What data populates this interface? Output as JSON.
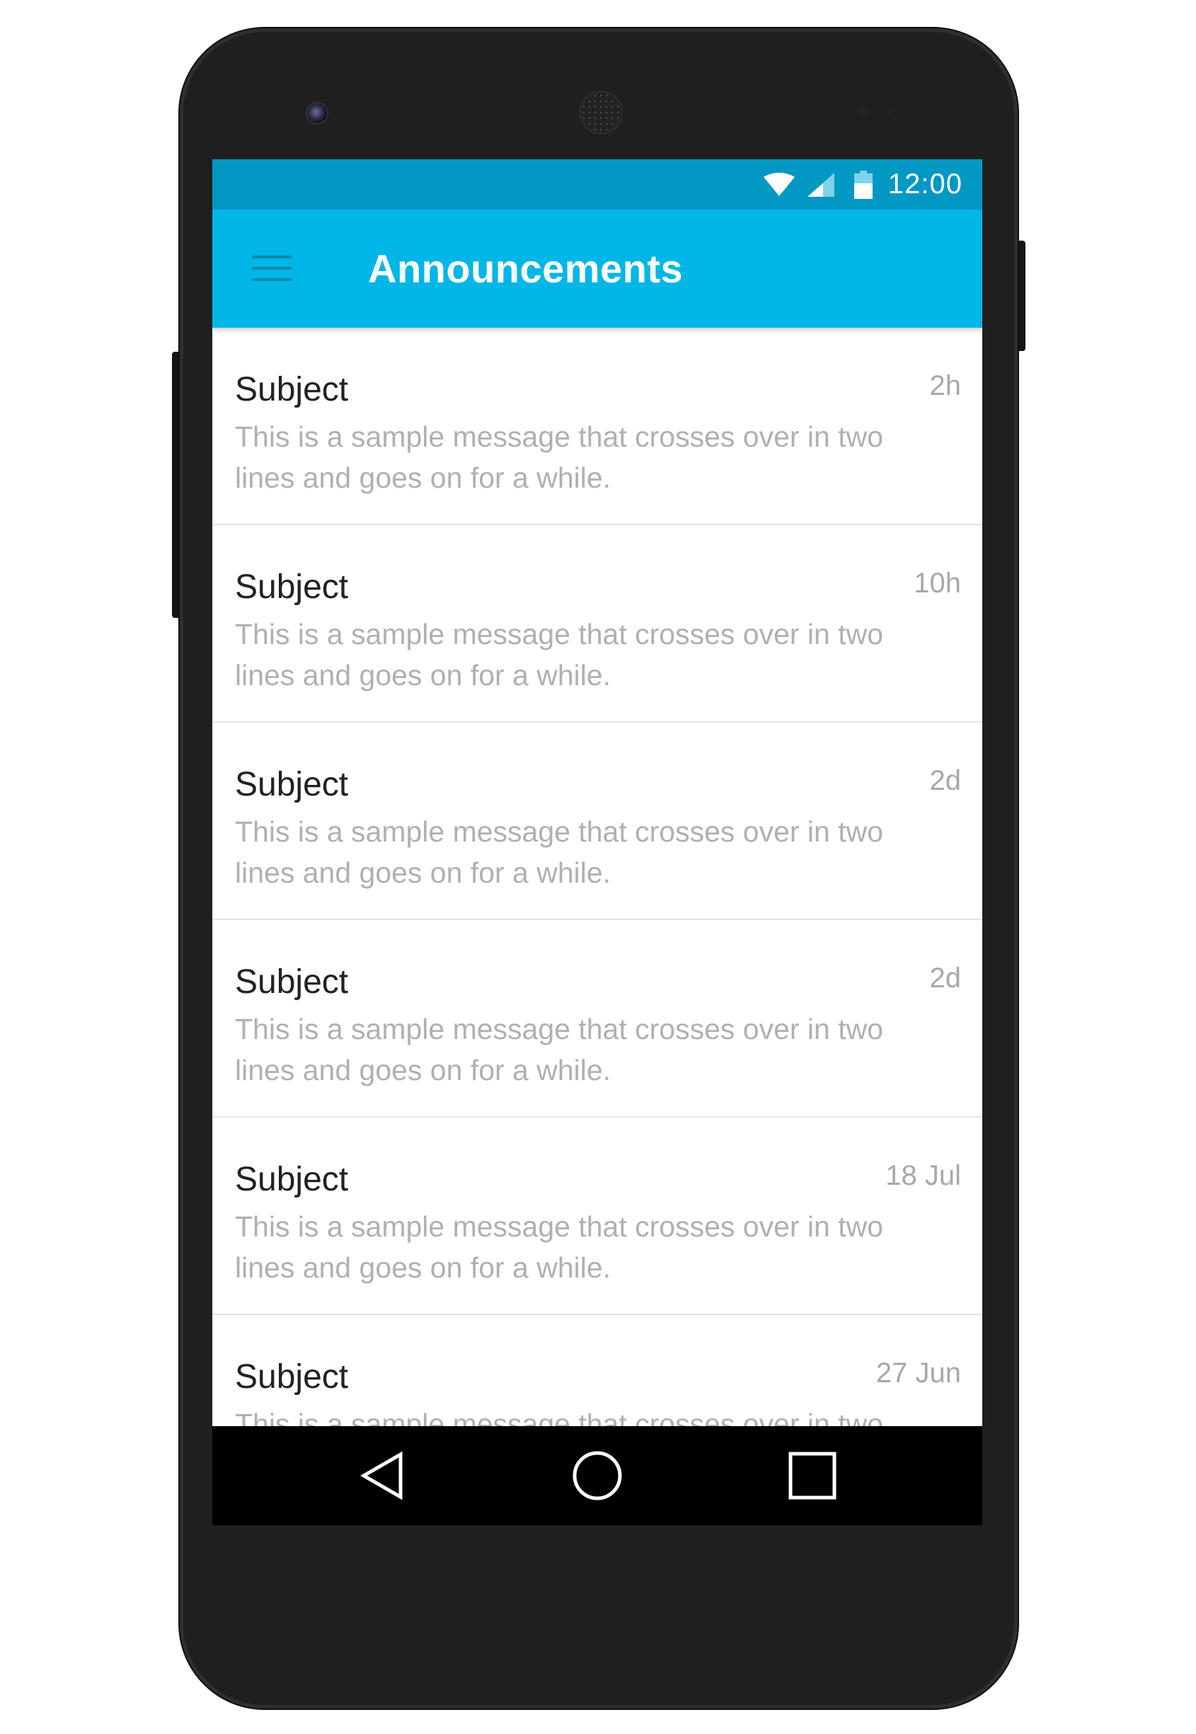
{
  "status_bar": {
    "time": "12:00",
    "icons": [
      "wifi-icon",
      "cell-signal-icon",
      "battery-icon"
    ]
  },
  "app_bar": {
    "menu_icon": "hamburger-menu-icon",
    "title": "Announcements",
    "color": "#00b6e6",
    "status_color": "#0198c4"
  },
  "announcements": [
    {
      "subject": "Subject",
      "time": "2h",
      "message": "This is a sample message that crosses over in two lines and goes on for a while."
    },
    {
      "subject": "Subject",
      "time": "10h",
      "message": "This is a sample message that crosses over in two lines and goes on for a while."
    },
    {
      "subject": "Subject",
      "time": "2d",
      "message": "This is a sample message that crosses over in two lines and goes on for a while."
    },
    {
      "subject": "Subject",
      "time": "2d",
      "message": "This is a sample message that crosses over in two lines and goes on for a while."
    },
    {
      "subject": "Subject",
      "time": "18 Jul",
      "message": "This is a sample message that crosses over in two lines and goes on for a while."
    },
    {
      "subject": "Subject",
      "time": "27 Jun",
      "message": "This is a sample message that crosses over in two lines and goes on for a while."
    }
  ],
  "nav_bar": {
    "buttons": [
      "back-icon",
      "home-icon",
      "recent-apps-icon"
    ]
  }
}
